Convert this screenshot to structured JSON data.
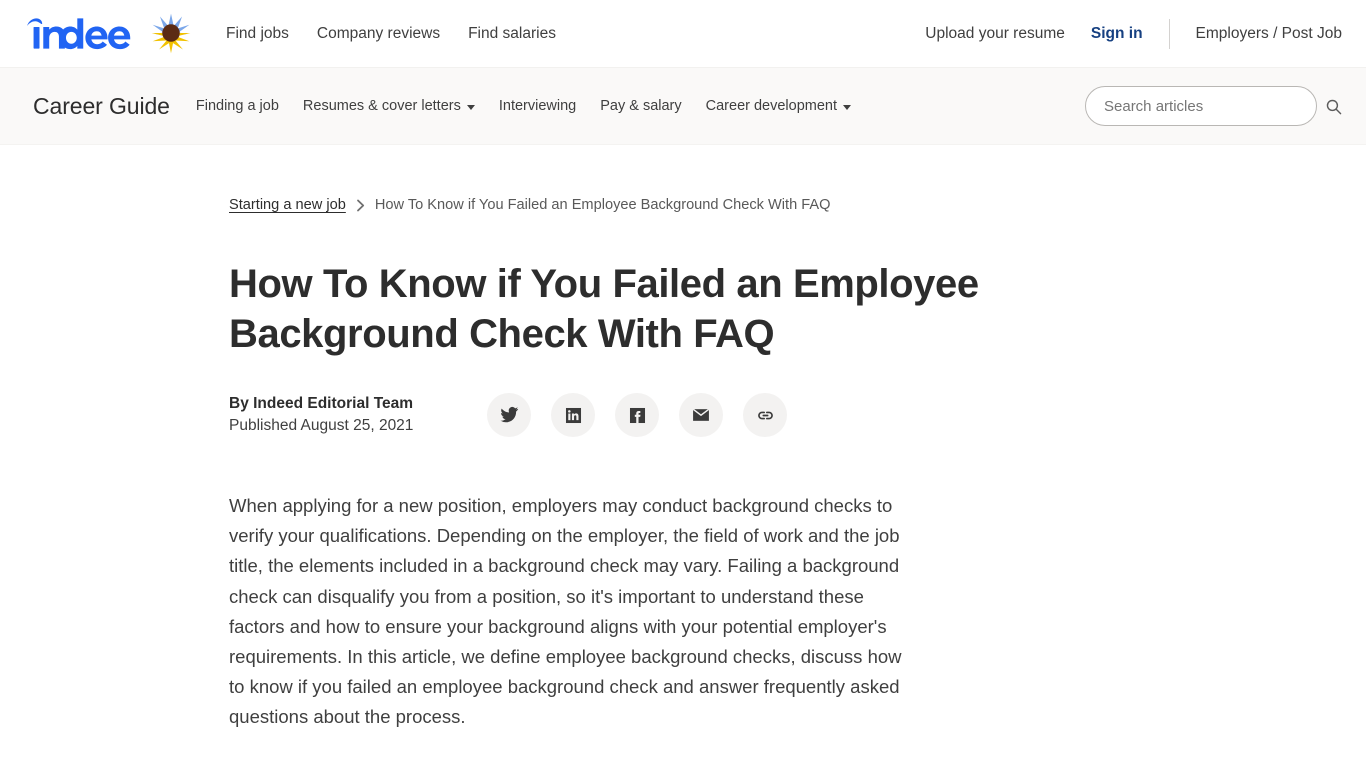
{
  "header": {
    "logo_text": "indeed",
    "logo_icon": "indeed-wordmark",
    "sunflower_icon": "sunflower-icon",
    "nav": [
      {
        "label": "Find jobs",
        "name": "nav-find-jobs"
      },
      {
        "label": "Company reviews",
        "name": "nav-company-reviews"
      },
      {
        "label": "Find salaries",
        "name": "nav-find-salaries"
      }
    ],
    "upload_resume": "Upload your resume",
    "sign_in": "Sign in",
    "employers": "Employers / Post Job",
    "sign_in_color": "#164081"
  },
  "guide": {
    "title": "Career Guide",
    "nav": [
      {
        "label": "Finding a job",
        "caret": false,
        "name": "guide-nav-finding-a-job"
      },
      {
        "label": "Resumes & cover letters",
        "caret": true,
        "name": "guide-nav-resumes-cover-letters"
      },
      {
        "label": "Interviewing",
        "caret": false,
        "name": "guide-nav-interviewing"
      },
      {
        "label": "Pay & salary",
        "caret": false,
        "name": "guide-nav-pay-salary"
      },
      {
        "label": "Career development",
        "caret": true,
        "name": "guide-nav-career-development"
      }
    ],
    "search": {
      "placeholder": "Search articles",
      "value": "",
      "icon": "search-icon"
    },
    "background_color": "#faf9f8"
  },
  "article": {
    "breadcrumb": {
      "parent": "Starting a new job",
      "separator": "›",
      "current": "How To Know if You Failed an Employee Background Check With FAQ"
    },
    "title": "How To Know if You Failed an Employee Background Check With FAQ",
    "author": "By Indeed Editorial Team",
    "published": "Published August 25, 2021",
    "share_buttons": [
      {
        "name": "share-twitter-button",
        "icon": "twitter-icon"
      },
      {
        "name": "share-linkedin-button",
        "icon": "linkedin-icon"
      },
      {
        "name": "share-facebook-button",
        "icon": "facebook-icon"
      },
      {
        "name": "share-email-button",
        "icon": "email-icon"
      },
      {
        "name": "share-link-button",
        "icon": "link-icon"
      }
    ],
    "body_paragraph": "When applying for a new position, employers may conduct background checks to verify your qualifications. Depending on the employer, the field of work and the job title, the elements included in a background check may vary. Failing a background check can disqualify you from a position, so it's important to understand these factors and how to ensure your background aligns with your potential employer's requirements. In this article, we define employee background checks, discuss how to know if you failed an employee background check and answer frequently asked questions about the process."
  }
}
